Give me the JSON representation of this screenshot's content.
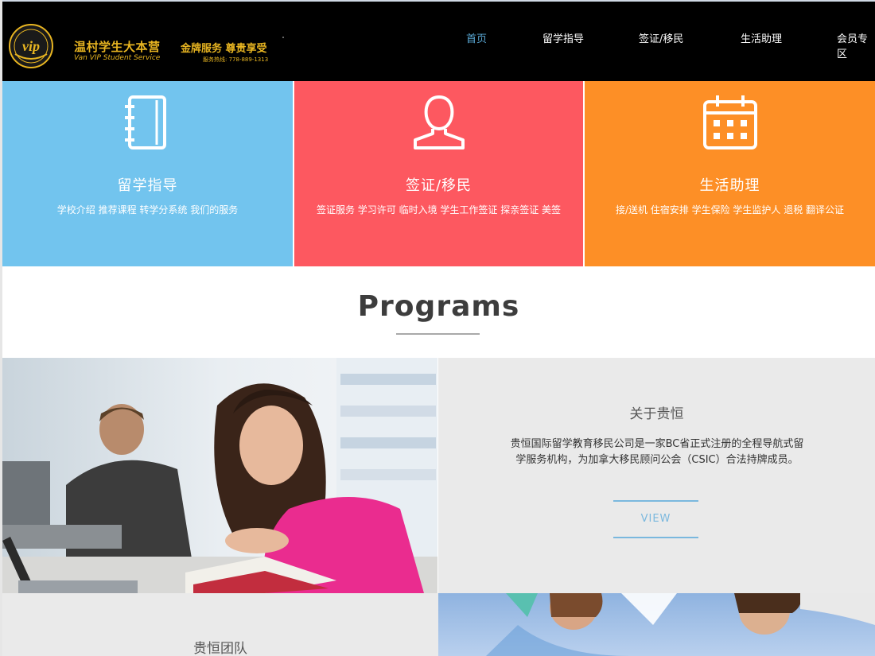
{
  "header": {
    "logo_cn": "温村学生大本营",
    "logo_en": "Van VIP Student Service",
    "logo_badge": "vip",
    "slogan": "金牌服务 尊贵享受",
    "hotline": "服务热线: 778-889-1313",
    "nav": [
      {
        "label": "首页",
        "active": true
      },
      {
        "label": "留学指导",
        "active": false
      },
      {
        "label": "签证/移民",
        "active": false
      },
      {
        "label": "生活助理",
        "active": false
      },
      {
        "label": "会员专区",
        "active": false
      }
    ]
  },
  "tiles": [
    {
      "icon": "notebook-icon",
      "title": "留学指导",
      "subtitle": "学校介绍  推荐课程  转学分系统  我们的服务",
      "color": "#72c4ee"
    },
    {
      "icon": "user-icon",
      "title": "签证/移民",
      "subtitle": "签证服务 学习许可 临时入境 学生工作签证 探亲签证 美签",
      "color": "#fd5860"
    },
    {
      "icon": "calendar-icon",
      "title": "生活助理",
      "subtitle": "接/送机 住宿安排 学生保险  学生监护人 退税 翻译公证",
      "color": "#fd8f26"
    }
  ],
  "programs": {
    "heading": "Programs"
  },
  "about": {
    "title": "关于贵恒",
    "text": "贵恒国际留学教育移民公司是一家BC省正式注册的全程导航式留学服务机构，为加拿大移民顾问公会（CSIC）合法持牌成员。",
    "button": "VIEW"
  },
  "team": {
    "title": "贵恒团队"
  }
}
